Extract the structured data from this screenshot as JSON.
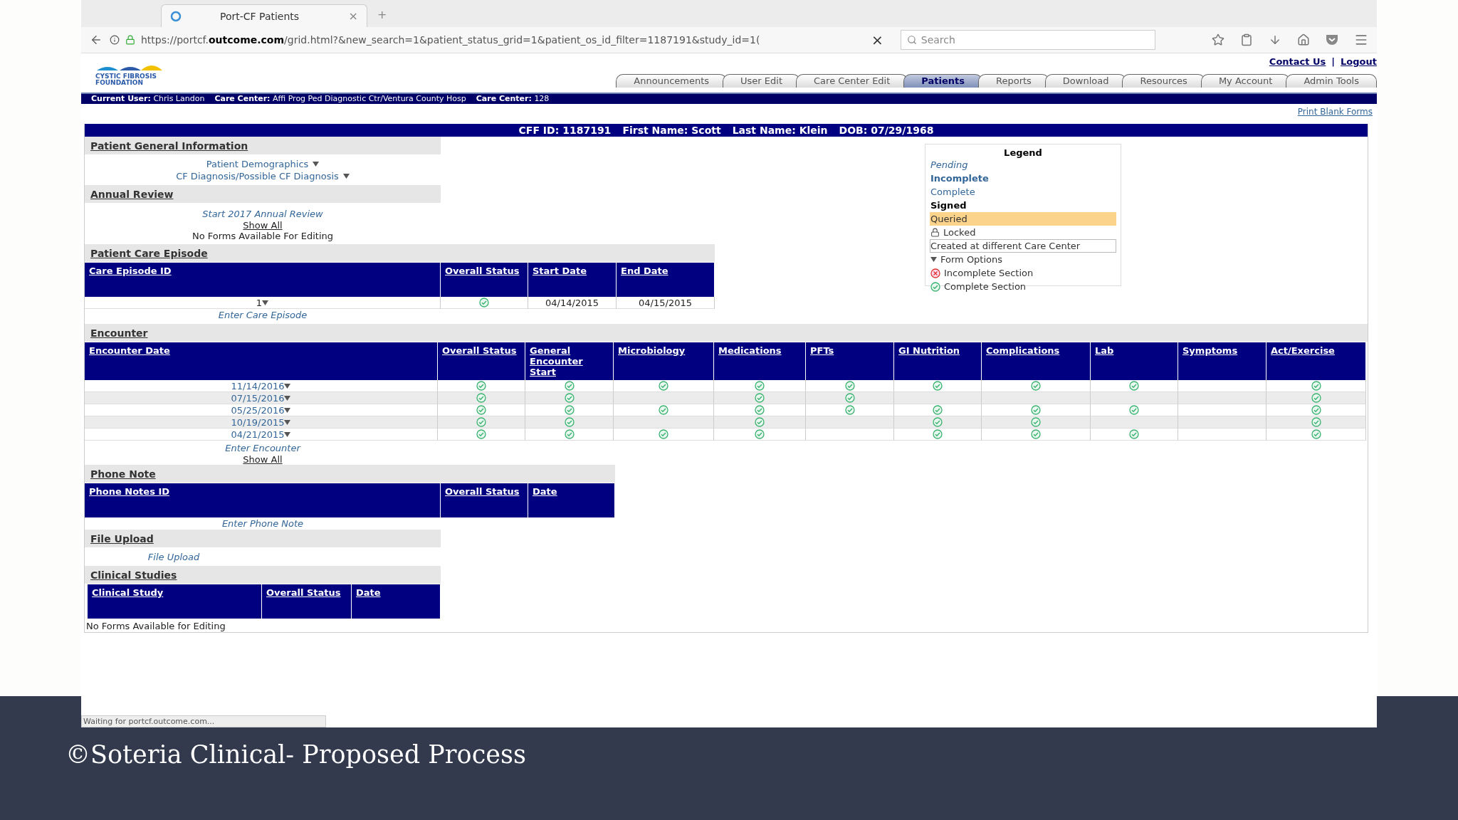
{
  "browser": {
    "tab": {
      "title": "Port-CF Patients",
      "close": "×",
      "new_tab": "+"
    },
    "url": "https://portcf.**outcome.com**/grid.html?&new_search=1&patient_status_grid=1&patient_os_id_filter=1187191&study_id=1(",
    "url_clear": "×",
    "search": {
      "placeholder": "Search"
    },
    "status": "Waiting for portcf.outcome.com..."
  },
  "site": {
    "logo": [
      "CYSTIC FIBROSIS",
      "FOUNDATION"
    ],
    "top_links": [
      "Contact Us",
      "|",
      "Logout"
    ],
    "nav": [
      {
        "label": "Announcements",
        "selected": false
      },
      {
        "label": "User Edit",
        "selected": false
      },
      {
        "label": "Care Center Edit",
        "selected": false
      },
      {
        "label": "Patients",
        "selected": true
      },
      {
        "label": "Reports",
        "selected": false
      },
      {
        "label": "Download",
        "selected": false
      },
      {
        "label": "Resources",
        "selected": false
      },
      {
        "label": "My Account",
        "selected": false
      },
      {
        "label": "Admin Tools",
        "selected": false
      }
    ],
    "user_bar": [
      {
        "label": "Current User:",
        "value": "Chris Landon"
      },
      {
        "label": "Care Center:",
        "value": "Affi Prog Ped Diagnostic Ctr/Ventura County Hosp"
      },
      {
        "label": "Care Center:",
        "value": "128"
      }
    ],
    "print_link": "Print Blank Forms"
  },
  "patient_header": [
    {
      "label": "CFF ID:",
      "value": "1187191"
    },
    {
      "label": "First Name:",
      "value": "Scott"
    },
    {
      "label": "Last Name:",
      "value": "Klein"
    },
    {
      "label": "DOB:",
      "value": "07/29/1968"
    }
  ],
  "general_info": {
    "title": "Patient General Information",
    "links": [
      "Patient Demographics",
      "CF Diagnosis/Possible CF Diagnosis"
    ]
  },
  "annual_review": {
    "title": "Annual Review",
    "link": "Start 2017 Annual Review",
    "show_all": "Show All",
    "note": "No Forms Available For Editing"
  },
  "care_episode": {
    "title": "Patient Care Episode",
    "columns": [
      "Care Episode ID",
      "Overall Status",
      "Start Date",
      "End Date"
    ],
    "rows": [
      {
        "id": "1",
        "complete": true,
        "start": "04/14/2015",
        "end": "04/15/2015"
      }
    ],
    "enter": "Enter Care Episode"
  },
  "encounter": {
    "title": "Encounter",
    "columns": [
      "Encounter Date",
      "Overall Status",
      "General Encounter Start",
      "Microbiology",
      "Medications",
      "PFTs",
      "GI Nutrition",
      "Complications",
      "Lab",
      "Symptoms",
      "Act/Exercise"
    ],
    "rows": [
      {
        "date": "11/14/2016",
        "cells": [
          true,
          true,
          true,
          true,
          true,
          true,
          true,
          true,
          false,
          true
        ]
      },
      {
        "date": "07/15/2016",
        "cells": [
          true,
          true,
          false,
          true,
          true,
          false,
          false,
          false,
          false,
          true
        ]
      },
      {
        "date": "05/25/2016",
        "cells": [
          true,
          true,
          true,
          true,
          true,
          true,
          true,
          true,
          false,
          true
        ]
      },
      {
        "date": "10/19/2015",
        "cells": [
          true,
          true,
          false,
          true,
          false,
          true,
          true,
          false,
          false,
          true
        ]
      },
      {
        "date": "04/21/2015",
        "cells": [
          true,
          true,
          true,
          true,
          false,
          true,
          true,
          true,
          false,
          true
        ]
      }
    ],
    "enter": "Enter Encounter",
    "show_all": "Show All"
  },
  "phone_note": {
    "title": "Phone Note",
    "columns": [
      "Phone Notes ID",
      "Overall Status",
      "Date"
    ],
    "enter": "Enter Phone Note"
  },
  "file_upload": {
    "title": "File Upload",
    "link": "File Upload"
  },
  "clinical_studies": {
    "title": "Clinical Studies",
    "columns": [
      "Clinical Study",
      "Overall Status",
      "Date"
    ],
    "note": "No Forms Available for Editing"
  },
  "legend": {
    "title": "Legend",
    "items": [
      {
        "kind": "pending",
        "label": "Pending"
      },
      {
        "kind": "incomplete",
        "label": "Incomplete"
      },
      {
        "kind": "complete",
        "label": "Complete"
      },
      {
        "kind": "signed",
        "label": "Signed"
      },
      {
        "kind": "queried",
        "label": "Queried"
      },
      {
        "kind": "locked",
        "label": "Locked"
      },
      {
        "kind": "other_center",
        "label": "Created at different Care Center"
      },
      {
        "kind": "form_options",
        "label": "Form Options"
      },
      {
        "kind": "incomplete_section",
        "label": "Incomplete Section"
      },
      {
        "kind": "complete_section",
        "label": "Complete Section"
      }
    ]
  },
  "caption": "©Soteria Clinical- Proposed Process"
}
